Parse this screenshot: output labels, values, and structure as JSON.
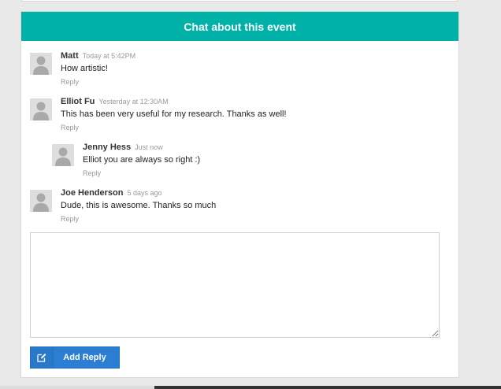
{
  "panel": {
    "title": "Chat about this event"
  },
  "comments": [
    {
      "name": "Matt",
      "time": "Today at 5:42PM",
      "text": "How artistic!",
      "reply": "Reply"
    },
    {
      "name": "Elliot Fu",
      "time": "Yesterday at 12:30AM",
      "text": "This has been very useful for my research. Thanks as well!",
      "reply": "Reply"
    },
    {
      "name": "Jenny Hess",
      "time": "Just now",
      "text": "Elliot you are always so right :)",
      "reply": "Reply"
    },
    {
      "name": "Joe Henderson",
      "time": "5 days ago",
      "text": "Dude, this is awesome. Thanks so much",
      "reply": "Reply"
    }
  ],
  "form": {
    "textarea_value": "",
    "button_label": "Add Reply",
    "button_icon": "edit-icon"
  },
  "colors": {
    "header": "#00b1a8",
    "button": "#2b7ed2"
  }
}
